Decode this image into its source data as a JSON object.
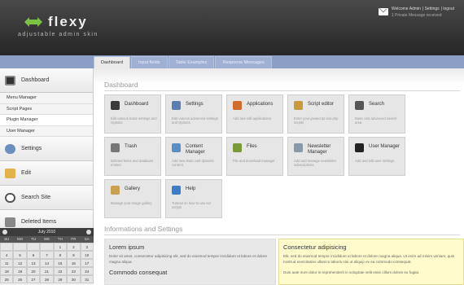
{
  "header": {
    "logo_title": "flexy",
    "logo_subtitle": "adjustable admin skin",
    "welcome": "Welcome Admin",
    "settings_link": "Settings",
    "logout_link": "logout",
    "messages": "1 Private Message received"
  },
  "tabs": [
    "Dashboard",
    "Input fields",
    "Table Examples",
    "Response Messages"
  ],
  "sidebar": {
    "dashboard": "Dashboard",
    "sub_items": [
      "Menu Manager",
      "Script Pages",
      "Plugin Manager",
      "User Manager"
    ],
    "settings": "Settings",
    "edit": "Edit",
    "search_site": "Search Site",
    "deleted_items": "Deleted Items"
  },
  "calendar": {
    "month": "July 2010",
    "days": [
      "SU",
      "MO",
      "TU",
      "WE",
      "TH",
      "FR",
      "SA"
    ],
    "cells": [
      "",
      "",
      "",
      "",
      "1",
      "2",
      "3",
      "4",
      "5",
      "6",
      "7",
      "8",
      "9",
      "10",
      "11",
      "12",
      "13",
      "14",
      "15",
      "16",
      "17",
      "18",
      "19",
      "20",
      "21",
      "22",
      "23",
      "24",
      "25",
      "26",
      "27",
      "28",
      "29",
      "30",
      "31"
    ]
  },
  "main": {
    "dashboard_title": "Dashboard",
    "info_title": "Informations and Settings",
    "tiles": [
      {
        "name": "Dashboard",
        "desc": "Edit various basic settings and Options",
        "icon": "monitor-icon",
        "color": "#3a3a3a"
      },
      {
        "name": "Settings",
        "desc": "Edit various advanced settings and Options",
        "icon": "gear-icon",
        "color": "#5b7fb0"
      },
      {
        "name": "Applications",
        "desc": "Add and edit applications",
        "icon": "tools-icon",
        "color": "#d26a2a"
      },
      {
        "name": "Script editor",
        "desc": "Enter your javascript and php scripts",
        "icon": "script-icon",
        "color": "#c99a3c"
      },
      {
        "name": "Search",
        "desc": "Basic and advanced search area",
        "icon": "magnifier-icon",
        "color": "#555555"
      },
      {
        "name": "Trash",
        "desc": "Deleted items and database entries",
        "icon": "trash-icon",
        "color": "#777777"
      },
      {
        "name": "Content Manager",
        "desc": "Add new static and dynamic content",
        "icon": "content-icon",
        "color": "#5a8fc6"
      },
      {
        "name": "Files",
        "desc": "File and download manager",
        "icon": "folder-icon",
        "color": "#7a9a3a"
      },
      {
        "name": "Newsletter Manager",
        "desc": "Add and manage newsletter subscriptions",
        "icon": "newsletter-icon",
        "color": "#8899aa"
      },
      {
        "name": "User Manager",
        "desc": "Add and edit user settings",
        "icon": "users-icon",
        "color": "#222222"
      },
      {
        "name": "Gallery",
        "desc": "Manage your image gallery",
        "icon": "gallery-icon",
        "color": "#c8a050"
      },
      {
        "name": "Help",
        "desc": "Tutorial on how to use our scripts",
        "icon": "help-icon",
        "color": "#3d7cc9"
      }
    ],
    "panel_left": {
      "title1": "Lorem ipsum",
      "text1": "Dolor sit amet, consectetur adipisicing elit, sed do eiusmod tempor incididunt ut labore et dolore magna aliqua.",
      "title2": "Commodo consequat"
    },
    "panel_right": {
      "title": "Consectetur adipisicing",
      "text1": "Elit, sed do eiusmod tempor incididunt ut labore et dolore magna aliqua. Ut enim ad minim veniam, quis nostrud exercitation ullamco laboris nisi ut aliquip ex ea commodo consequat.",
      "text2": "Duis aute irure dolor in reprehenderit in voluptate velit esse cillum dolore eu fugiat."
    }
  }
}
